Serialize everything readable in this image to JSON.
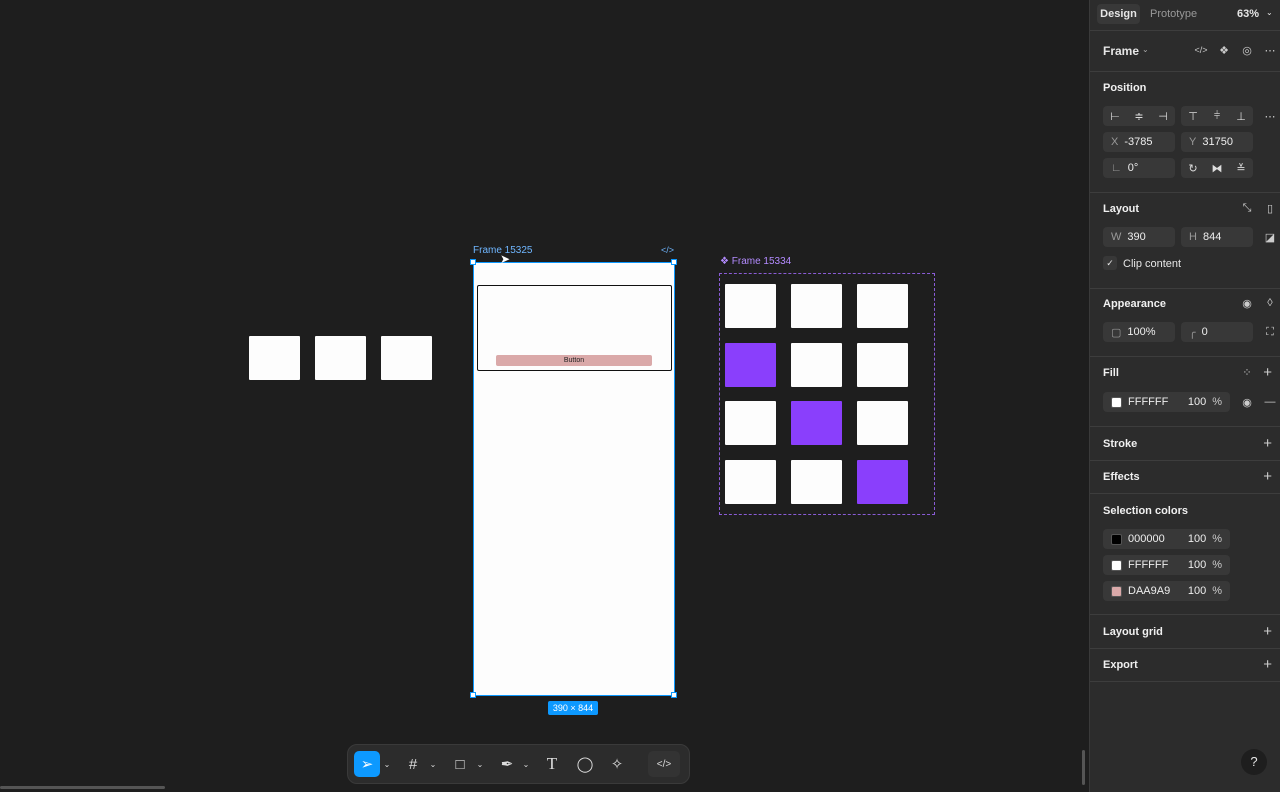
{
  "canvas": {
    "frame_label": "Frame 15325",
    "frame_size": "390 × 844",
    "button_label": "Button",
    "grid_frame_label": "Frame 15334",
    "grid": [
      [
        "white",
        "white",
        "white"
      ],
      [
        "purple",
        "white",
        "white"
      ],
      [
        "white",
        "purple",
        "white"
      ],
      [
        "white",
        "white",
        "purple"
      ]
    ],
    "colors": {
      "accent": "#0d99ff",
      "purple": "#8a3ffc",
      "button": "#DAA9A9",
      "component": "#b38bff"
    }
  },
  "toolbar": {
    "tools": [
      "move-icon",
      "frame-icon",
      "rectangle-icon",
      "pen-icon",
      "text-icon",
      "comment-icon",
      "ai-icon",
      "code-icon"
    ]
  },
  "panel": {
    "tabs": {
      "design": "Design",
      "prototype": "Prototype",
      "zoom": "63%"
    },
    "selection": "Frame",
    "position": {
      "title": "Position",
      "x_label": "X",
      "x": "-3785",
      "y_label": "Y",
      "y": "31750",
      "rotation": "0°"
    },
    "layout": {
      "title": "Layout",
      "w_label": "W",
      "w": "390",
      "h_label": "H",
      "h": "844",
      "clip": "Clip content",
      "clip_checked": true
    },
    "appearance": {
      "title": "Appearance",
      "opacity": "100%",
      "radius": "0"
    },
    "fill": {
      "title": "Fill",
      "hex": "FFFFFF",
      "opacity": "100",
      "unit": "%"
    },
    "stroke": {
      "title": "Stroke"
    },
    "effects": {
      "title": "Effects"
    },
    "selection_colors": {
      "title": "Selection colors",
      "items": [
        {
          "hex": "000000",
          "opacity": "100",
          "unit": "%",
          "color": "#000000"
        },
        {
          "hex": "FFFFFF",
          "opacity": "100",
          "unit": "%",
          "color": "#FFFFFF"
        },
        {
          "hex": "DAA9A9",
          "opacity": "100",
          "unit": "%",
          "color": "#DAA9A9"
        }
      ]
    },
    "layout_grid": {
      "title": "Layout grid"
    },
    "export": {
      "title": "Export"
    },
    "help": "?"
  }
}
